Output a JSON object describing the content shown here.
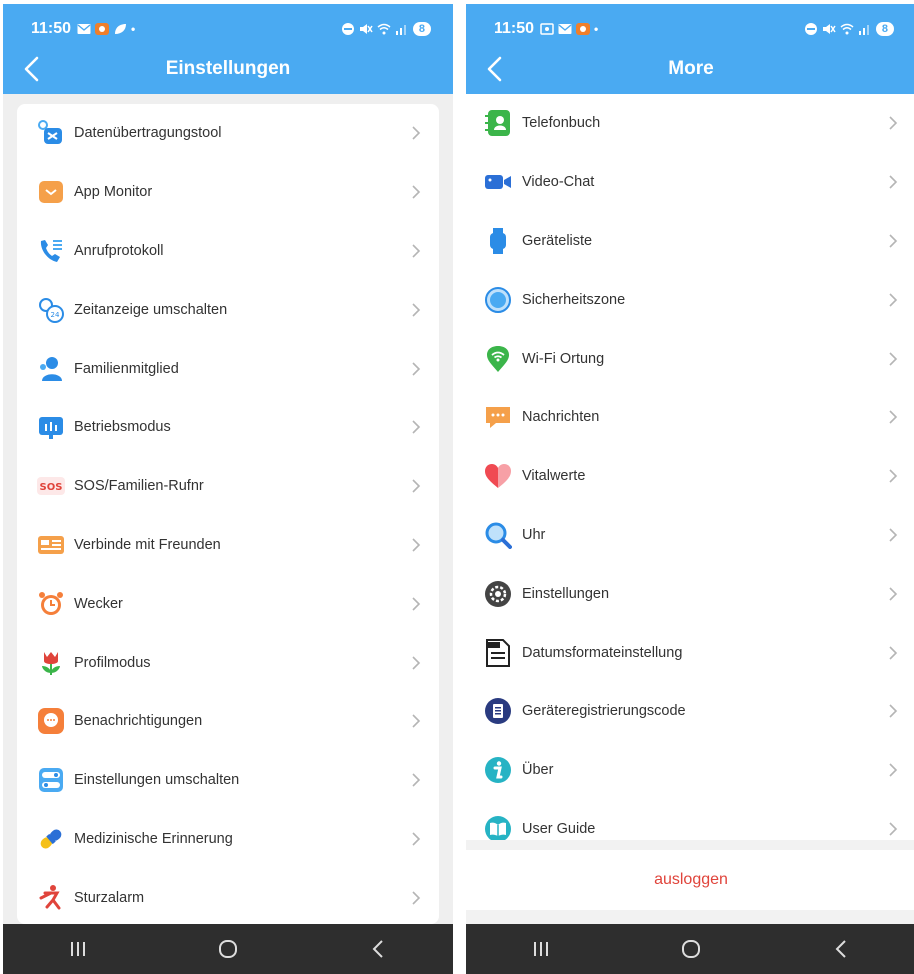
{
  "status": {
    "time": "11:50",
    "battery": "8"
  },
  "left": {
    "title": "Einstellungen",
    "items": [
      {
        "label": "Datenübertragungstool",
        "icon": "data-transfer-icon"
      },
      {
        "label": "App Monitor",
        "icon": "app-monitor-icon"
      },
      {
        "label": "Anrufprotokoll",
        "icon": "call-log-icon"
      },
      {
        "label": "Zeitanzeige umschalten",
        "icon": "time-format-icon"
      },
      {
        "label": "Familienmitglied",
        "icon": "family-member-icon"
      },
      {
        "label": "Betriebsmodus",
        "icon": "operation-mode-icon"
      },
      {
        "label": "SOS/Familien-Rufnr",
        "icon": "sos-icon"
      },
      {
        "label": "Verbinde mit Freunden",
        "icon": "friends-card-icon"
      },
      {
        "label": "Wecker",
        "icon": "alarm-clock-icon"
      },
      {
        "label": "Profilmodus",
        "icon": "profile-tulip-icon"
      },
      {
        "label": "Benachrichtigungen",
        "icon": "notification-bubble-icon"
      },
      {
        "label": "Einstellungen umschalten",
        "icon": "toggle-settings-icon"
      },
      {
        "label": "Medizinische Erinnerung",
        "icon": "pill-icon"
      },
      {
        "label": "Sturzalarm",
        "icon": "fall-alarm-icon"
      }
    ]
  },
  "right": {
    "title": "More",
    "items": [
      {
        "label": "Telefonbuch",
        "icon": "phonebook-icon"
      },
      {
        "label": "Video-Chat",
        "icon": "video-camera-icon"
      },
      {
        "label": "Geräteliste",
        "icon": "watch-icon"
      },
      {
        "label": "Sicherheitszone",
        "icon": "safe-zone-icon"
      },
      {
        "label": "Wi-Fi Ortung",
        "icon": "wifi-location-icon"
      },
      {
        "label": "Nachrichten",
        "icon": "message-icon"
      },
      {
        "label": "Vitalwerte",
        "icon": "heart-icon"
      },
      {
        "label": "Uhr",
        "icon": "magnifier-icon"
      },
      {
        "label": "Einstellungen",
        "icon": "gear-icon"
      },
      {
        "label": "Datumsformateinstellung",
        "icon": "date-format-icon"
      },
      {
        "label": "Geräteregistrierungscode",
        "icon": "registration-code-icon"
      },
      {
        "label": "Über",
        "icon": "info-icon"
      },
      {
        "label": "User Guide",
        "icon": "user-guide-book-icon"
      }
    ],
    "logout": "ausloggen"
  },
  "colors": {
    "header": "#4aaaf2",
    "logout": "#e0443b",
    "navbar": "#2e2e2e"
  }
}
